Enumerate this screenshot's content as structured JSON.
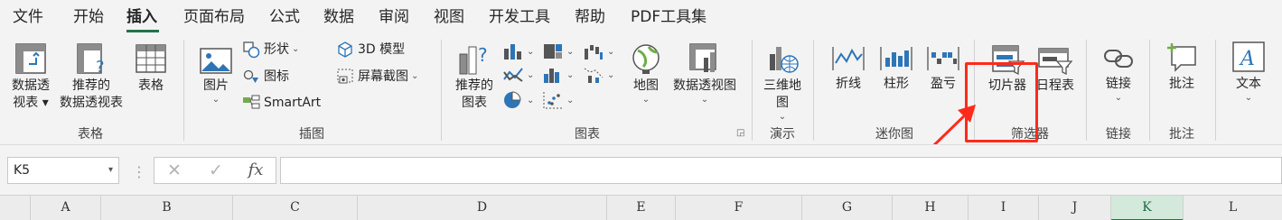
{
  "tabs": [
    "文件",
    "开始",
    "插入",
    "页面布局",
    "公式",
    "数据",
    "审阅",
    "视图",
    "开发工具",
    "帮助",
    "PDF工具集"
  ],
  "active_tab": "插入",
  "groups": {
    "tables": {
      "label": "表格",
      "pivot_table": [
        "数据透",
        "视表 ▾"
      ],
      "recommended_pivot": [
        "推荐的",
        "数据透视表"
      ],
      "table": "表格"
    },
    "illustrations": {
      "label": "插图",
      "pictures": "图片",
      "shapes": "形状",
      "icons": "图标",
      "smartart": "SmartArt",
      "model_3d": "3D 模型",
      "screenshot": "屏幕截图"
    },
    "charts": {
      "label": "图表",
      "recommended_charts": [
        "推荐的",
        "图表"
      ],
      "maps": "地图",
      "pivot_chart": "数据透视图"
    },
    "tours": {
      "label": "演示",
      "map_3d": [
        "三维地",
        "图"
      ]
    },
    "sparklines": {
      "label": "迷你图",
      "line": "折线",
      "column": "柱形",
      "win_loss": "盈亏"
    },
    "filters": {
      "label": "筛选器",
      "slicer": "切片器",
      "timeline": "日程表"
    },
    "links": {
      "label": "链接",
      "link": "链接"
    },
    "comments": {
      "label": "批注",
      "comment": "批注"
    },
    "text": {
      "label": "文本"
    }
  },
  "formula_bar": {
    "name_box": "K5",
    "cancel": "✕",
    "enter": "✓",
    "fx": "fx",
    "formula": ""
  },
  "columns": [
    "A",
    "B",
    "C",
    "D",
    "E",
    "F",
    "G",
    "H",
    "I",
    "J",
    "K",
    "L"
  ],
  "selected_column": "K",
  "colors": {
    "accent": "#217346",
    "callout": "#ff2a1a",
    "background": "#f3f3f3"
  }
}
